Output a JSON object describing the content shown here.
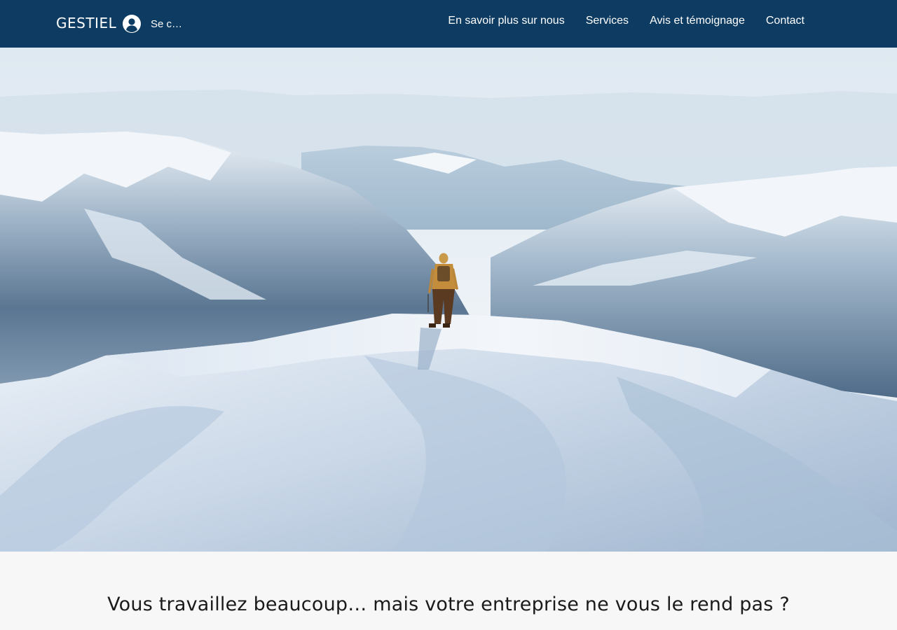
{
  "header": {
    "brand": "GESTIEL",
    "login_label": "Se c…",
    "login_icon": "user-avatar-icon",
    "background": "#0d3b61",
    "nav": [
      {
        "label": "En savoir plus sur nous"
      },
      {
        "label": "Services"
      },
      {
        "label": "Avis et témoignage"
      },
      {
        "label": "Contact"
      }
    ]
  },
  "hero": {
    "image": "snowy-mountain-summit-with-hiker"
  },
  "main": {
    "tagline": "Vous travaillez beaucoup… mais votre entreprise ne vous le rend pas ?"
  }
}
